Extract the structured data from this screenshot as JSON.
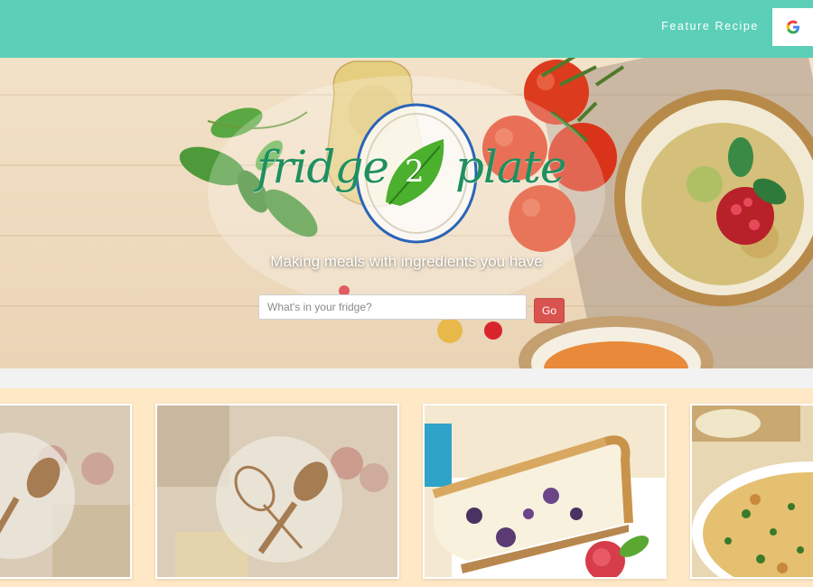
{
  "nav": {
    "feature_recipe": "Feature Recipe",
    "google_icon": "google-g-icon"
  },
  "hero": {
    "logo_left": "fridge",
    "logo_number": "2",
    "logo_right": "plate",
    "tagline": "Making meals with ingredients you have",
    "search_placeholder": "What's in your fridge?",
    "go_label": "Go"
  },
  "cards": [
    {
      "image": "placeholder-utensils-icon"
    },
    {
      "image": "placeholder-utensils-icon"
    },
    {
      "image": "blueberry-cheesecake"
    },
    {
      "image": "herb-casserole"
    }
  ],
  "colors": {
    "navbar": "#5ccfb8",
    "go_button": "#d9534f",
    "logo_green": "#1f8f5f",
    "cards_background": "#ffe8c6"
  }
}
